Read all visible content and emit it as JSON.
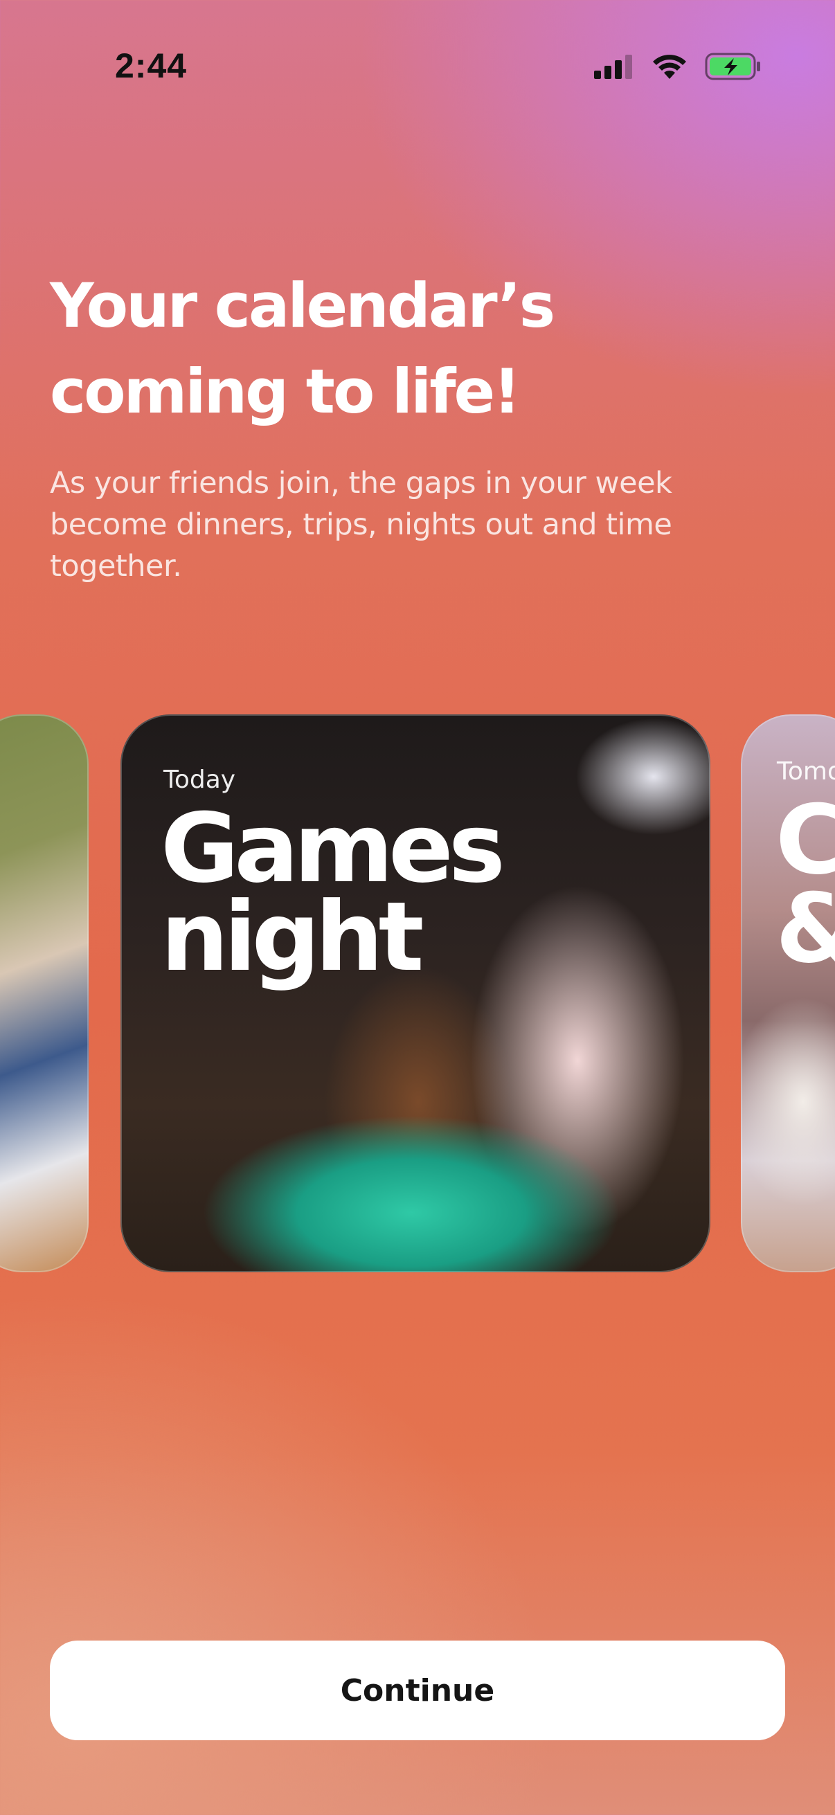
{
  "status_bar": {
    "time": "2:44",
    "icons": [
      "cellular-signal-icon",
      "wifi-icon",
      "battery-charging-icon"
    ],
    "battery_color": "#4cd964"
  },
  "onboarding": {
    "headline": "Your calendar’s coming to life!",
    "subtitle": "As your friends join, the gaps in your week become dinners, trips, nights out and time together."
  },
  "cards": {
    "main": {
      "label": "Today",
      "title_line1": "Games",
      "title_line2": "night"
    },
    "next": {
      "label": "Tomo",
      "title_line1": "C",
      "title_line2": "&"
    }
  },
  "footer": {
    "continue_label": "Continue"
  },
  "colors": {
    "accent": "#e36a4c",
    "gradient_top": "#c97ce0",
    "button_bg": "#ffffff",
    "text_primary": "#ffffff"
  }
}
